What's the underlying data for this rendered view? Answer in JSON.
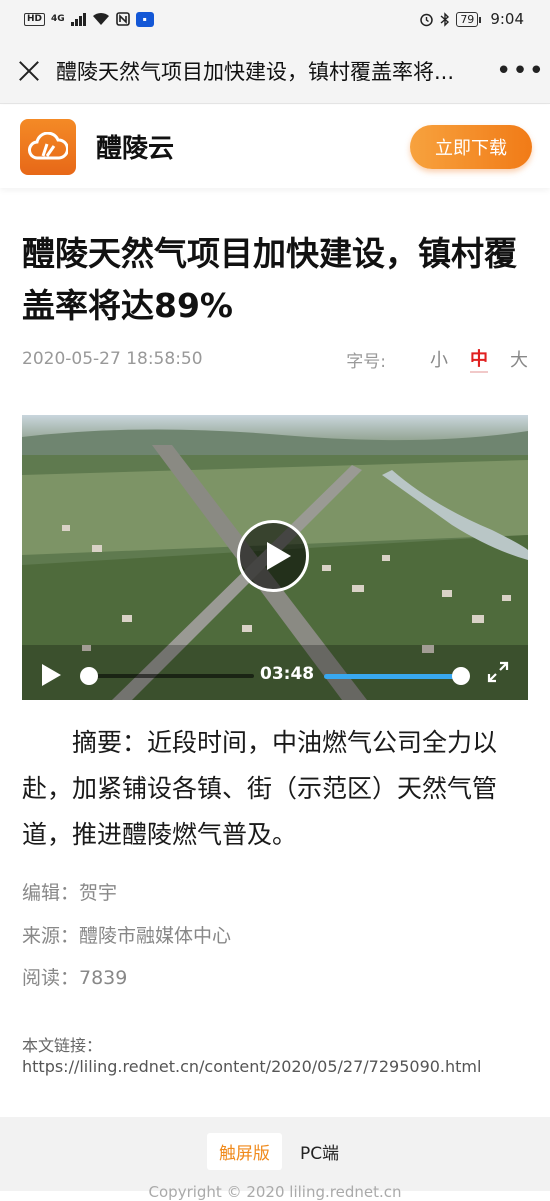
{
  "status_bar": {
    "hd": "HD",
    "network": "4G",
    "battery": "79",
    "time": "9:04"
  },
  "nav": {
    "title": "醴陵天然气项目加快建设，镇村覆盖率将..."
  },
  "app_banner": {
    "name": "醴陵云",
    "download_label": "立即下载",
    "brand_color": "#f07d1c"
  },
  "article": {
    "headline": "醴陵天然气项目加快建设，镇村覆盖率将达89%",
    "date": "2020-05-27 18:58:50",
    "font_size": {
      "label": "字号:",
      "options": [
        "小",
        "中",
        "大"
      ],
      "selected": "中"
    },
    "video": {
      "duration": "03:48",
      "progress": 0.0,
      "volume": 1.0
    },
    "summary": "摘要：近段时间，中油燃气公司全力以赴，加紧铺设各镇、街（示范区）天然气管道，推进醴陵燃气普及。",
    "editor": "编辑：贺宇",
    "source": "来源：醴陵市融媒体中心",
    "reads": "阅读：7839",
    "link_label": "本文链接：",
    "link_url": "https://liling.rednet.cn/content/2020/05/27/7295090.html"
  },
  "footer": {
    "tabs": [
      "触屏版",
      "PC端"
    ],
    "active_tab": "触屏版",
    "copyright": "Copyright © 2020 liling.rednet.cn"
  }
}
